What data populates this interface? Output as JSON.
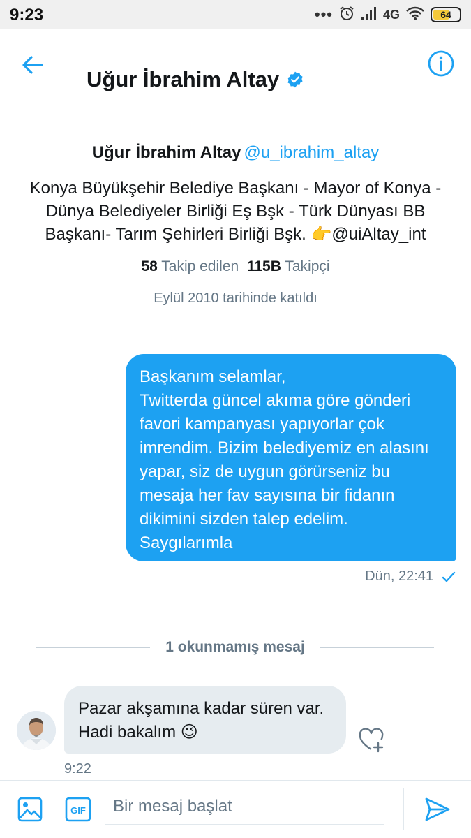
{
  "status_bar": {
    "time": "9:23",
    "dots": "•••",
    "network": "4G",
    "battery": "64",
    "battery_level_percent": 64
  },
  "header": {
    "title": "Uğur İbrahim Altay",
    "verified": true
  },
  "profile": {
    "name": "Uğur İbrahim Altay",
    "handle": "@u_ibrahim_altay",
    "bio": "Konya Büyükşehir Belediye Başkanı - Mayor of Konya - Dünya Belediyeler Birliği Eş Bşk - Türk Dünyası BB Başkanı- Tarım Şehirleri Birliği Bşk. 👉@uiAltay_int",
    "following_count": "58",
    "following_label": "Takip edilen",
    "followers_count": "115B",
    "followers_label": "Takipçi",
    "joined": "Eylül 2010 tarihinde katıldı"
  },
  "messages": {
    "outgoing": {
      "lines": [
        "Başkanım selamlar,",
        "Twitterda güncel akıma göre gönderi favori kampanyası yapıyorlar çok imrendim. Bizim belediyemiz en alasını yapar, siz de uygun görürseniz bu mesaja her fav sayısına bir fidanın dikimini sizden talep edelim.",
        "Saygılarımla"
      ],
      "timestamp": "Dün, 22:41"
    },
    "unread_separator": "1 okunmamış mesaj",
    "incoming": {
      "text": "Pazar akşamına kadar süren var. Hadi bakalım 😉",
      "timestamp": "9:22"
    }
  },
  "composer": {
    "placeholder": "Bir mesaj başlat",
    "value": ""
  },
  "colors": {
    "accent": "#1da1f2",
    "secondary_text": "#657786",
    "incoming_bubble": "#e6ecf0",
    "border": "#e1e8ed"
  },
  "icons": [
    "back-arrow-icon",
    "info-icon",
    "verified-badge-icon",
    "alarm-icon",
    "signal-icon",
    "wifi-icon",
    "battery-icon",
    "read-check-icon",
    "add-reaction-icon",
    "image-icon",
    "gif-icon",
    "send-icon"
  ]
}
